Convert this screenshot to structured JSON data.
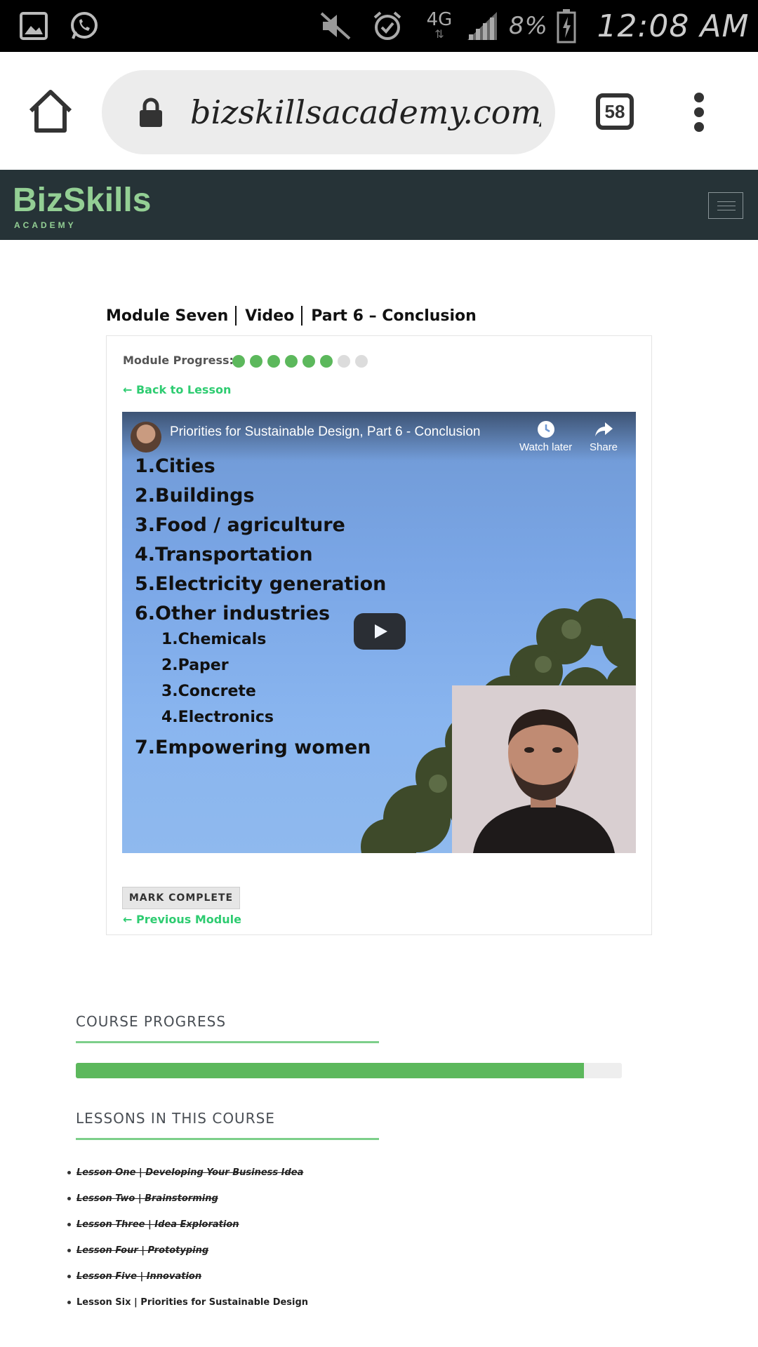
{
  "status_bar": {
    "battery": "8%",
    "network": "4G",
    "time": "12:08 AM",
    "icons": [
      "gallery-icon",
      "whatsapp-icon",
      "mute-icon",
      "alarm-icon",
      "network-4g-icon",
      "signal-icon",
      "battery-icon"
    ]
  },
  "browser": {
    "url": "bizskillsacademy.com/",
    "tab_count": "58"
  },
  "site": {
    "logo_main": "BizSkills",
    "logo_sub": "ACADEMY",
    "brand_color": "#93cf94",
    "header_bg": "#263337"
  },
  "lesson": {
    "title_parts": [
      "Module Seven",
      "Video",
      "Part 6 – Conclusion"
    ],
    "module_progress_label": "Module Progress:",
    "module_progress": {
      "completed": 6,
      "total": 8
    },
    "back_link": "← Back to Lesson",
    "mark_complete": "MARK COMPLETE",
    "previous_module": "← Previous Module"
  },
  "video": {
    "title": "Priorities for Sustainable Design, Part 6 - Conclusion",
    "watch_later": "Watch later",
    "share": "Share",
    "slide_items": [
      {
        "text": "1.Cities",
        "level": "main"
      },
      {
        "text": "2.Buildings",
        "level": "main"
      },
      {
        "text": "3.Food / agriculture",
        "level": "main"
      },
      {
        "text": "4.Transportation",
        "level": "main"
      },
      {
        "text": "5.Electricity generation",
        "level": "main"
      },
      {
        "text": "6.Other industries",
        "level": "main"
      },
      {
        "text": "1.Chemicals",
        "level": "sub"
      },
      {
        "text": "2.Paper",
        "level": "sub"
      },
      {
        "text": "3.Concrete",
        "level": "sub"
      },
      {
        "text": "4.Electronics",
        "level": "sub"
      },
      {
        "text": "7.Empowering women",
        "level": "main"
      }
    ]
  },
  "course_progress": {
    "heading": "COURSE PROGRESS",
    "percent": 93,
    "accent": "#5cb85c"
  },
  "lessons_in_course": {
    "heading": "LESSONS IN THIS COURSE",
    "items": [
      {
        "label": "Lesson One | Developing Your Business Idea",
        "completed": true
      },
      {
        "label": "Lesson Two | Brainstorming",
        "completed": true
      },
      {
        "label": "Lesson Three | Idea Exploration",
        "completed": true
      },
      {
        "label": "Lesson Four | Prototyping",
        "completed": true
      },
      {
        "label": "Lesson Five | Innovation",
        "completed": true
      },
      {
        "label": "Lesson Six | Priorities for Sustainable Design",
        "completed": false
      }
    ]
  }
}
